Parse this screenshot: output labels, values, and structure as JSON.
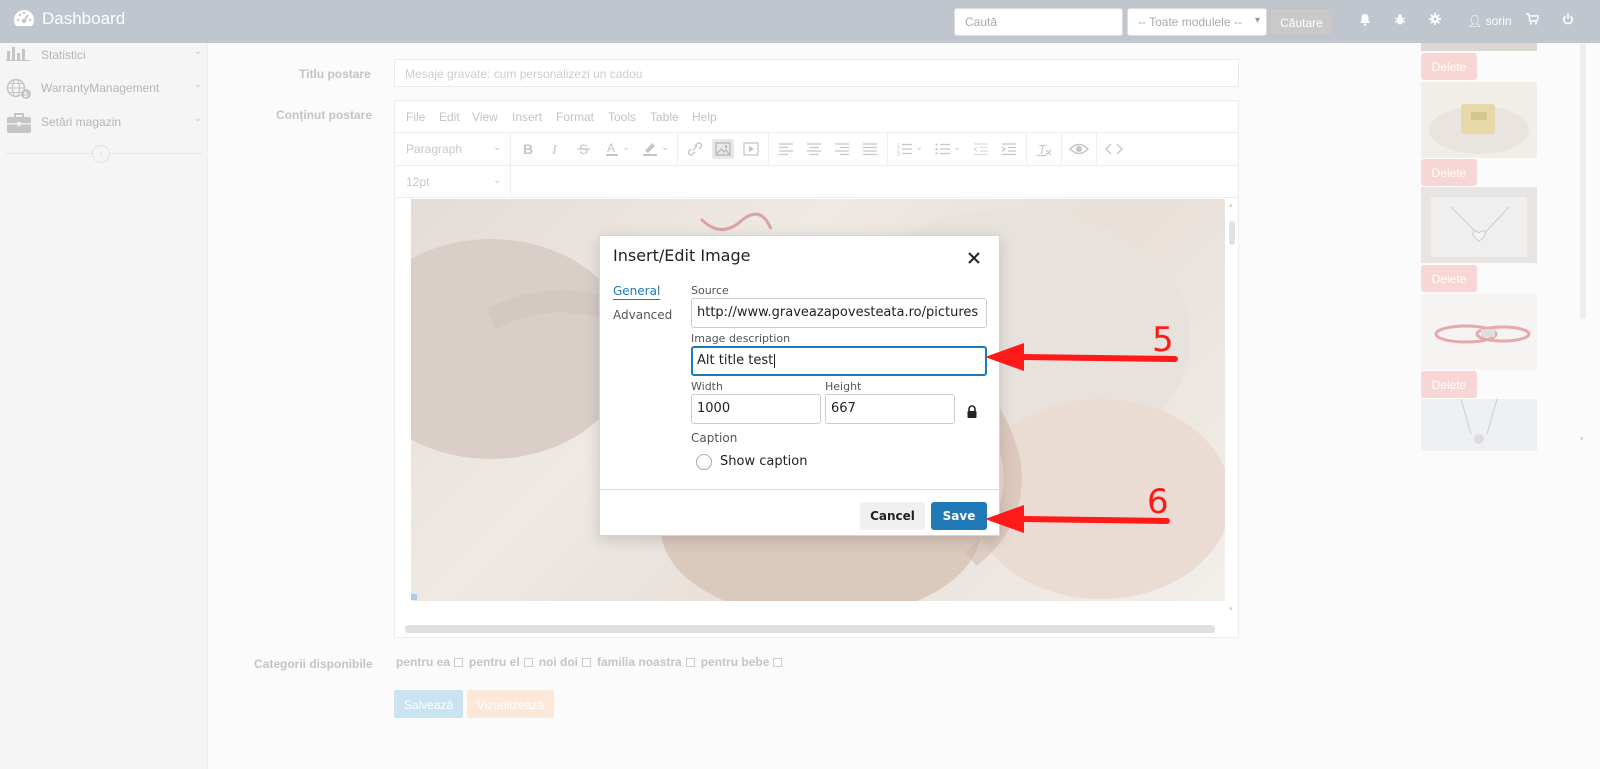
{
  "navbar": {
    "brand": "Dashboard",
    "search_placeholder": "Caută",
    "module_select": "-- Toate modulele --",
    "search_button": "Căutare",
    "user": "sorin"
  },
  "sidebar": {
    "items": [
      {
        "label": "Statistici",
        "icon": "bar-chart-icon"
      },
      {
        "label": "WarrantyManagement",
        "icon": "globe-dollar-icon"
      },
      {
        "label": "Setări magazin",
        "icon": "briefcase-icon"
      }
    ]
  },
  "form": {
    "title_label": "Titlu postare",
    "title_value": "Mesaje gravate: cum personalizezi un cadou",
    "content_label": "Conținut postare",
    "categories_label": "Categorii disponibile",
    "categories": [
      "pentru ea",
      "pentru el",
      "noi doi",
      "familia noastra",
      "pentru bebe"
    ],
    "save_button": "Salvează",
    "preview_button": "Vizualizează"
  },
  "editor": {
    "menu": [
      "File",
      "Edit",
      "View",
      "Insert",
      "Format",
      "Tools",
      "Table",
      "Help"
    ],
    "block_format": "Paragraph",
    "font_size": "12pt"
  },
  "gallery": {
    "delete_label": "Delete"
  },
  "dialog": {
    "title": "Insert/Edit Image",
    "tabs": [
      "General",
      "Advanced"
    ],
    "source_label": "Source",
    "source_value": "http://www.graveazapovesteata.ro/pictures",
    "description_label": "Image description",
    "description_value": "Alt title test",
    "width_label": "Width",
    "width_value": "1000",
    "height_label": "Height",
    "height_value": "667",
    "caption_label": "Caption",
    "show_caption_label": "Show caption",
    "cancel_button": "Cancel",
    "save_button": "Save"
  },
  "annotations": {
    "step_5": "5",
    "step_6": "6",
    "arrow_color": "#ff1a1a"
  }
}
